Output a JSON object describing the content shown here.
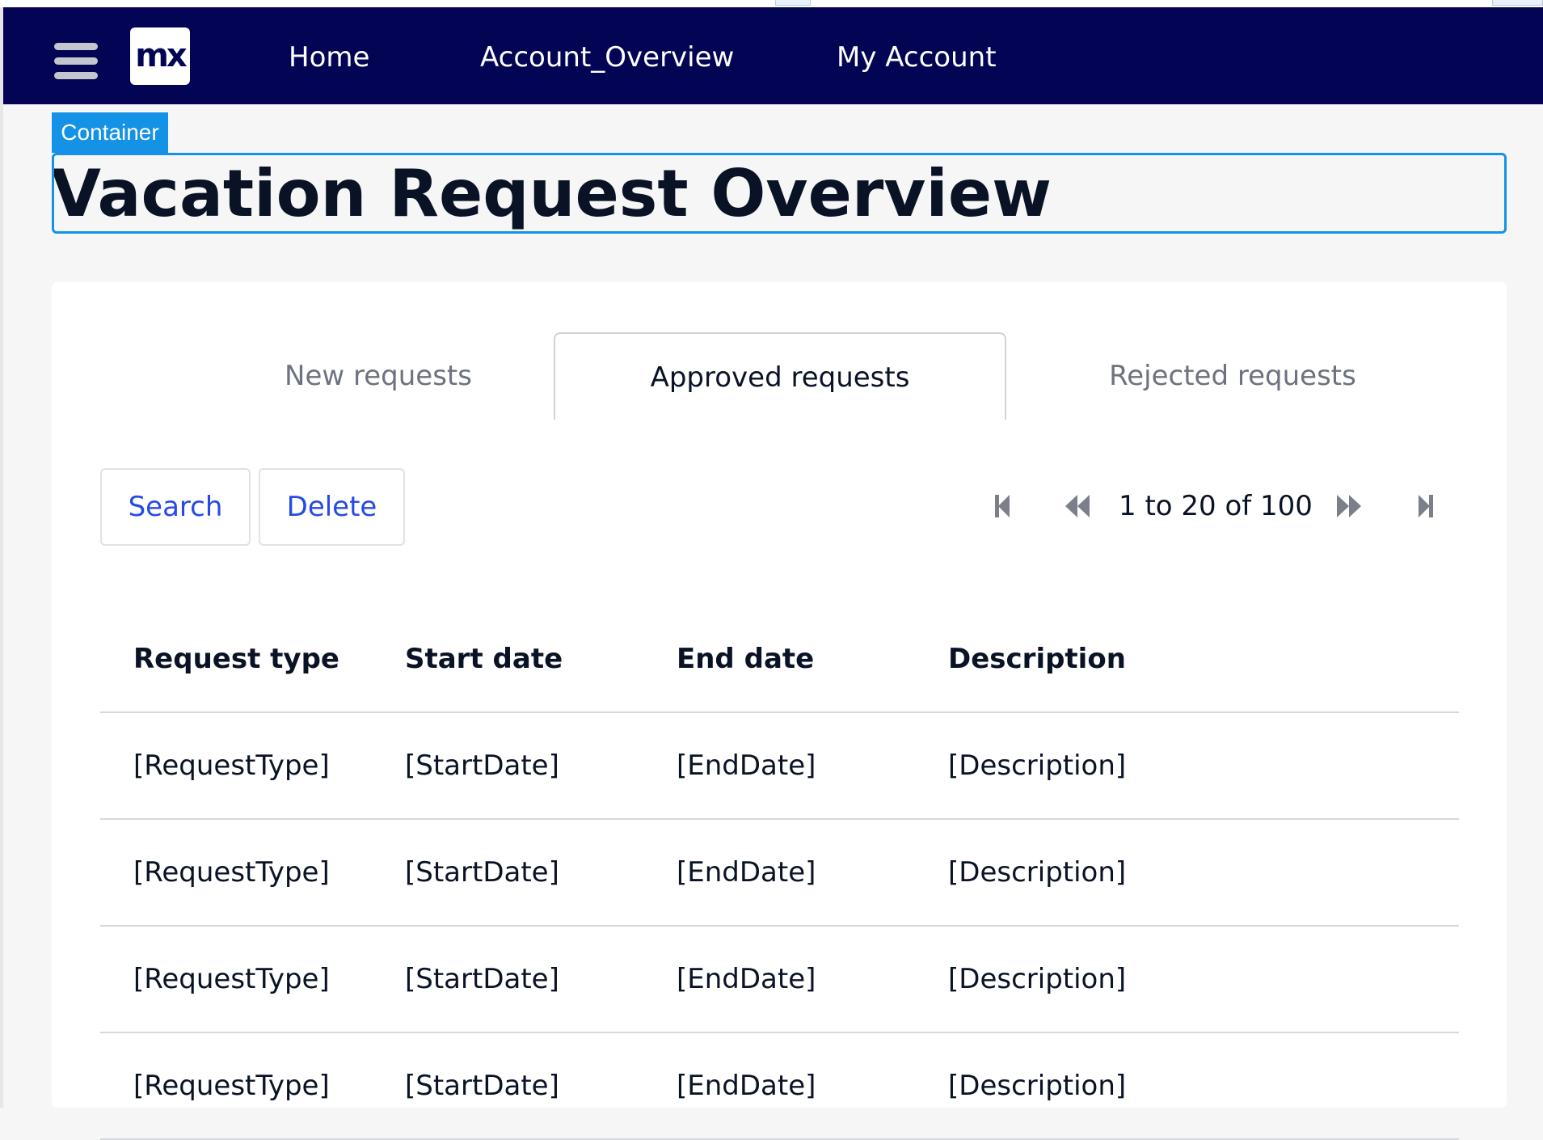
{
  "navbar": {
    "logo_text": "mx",
    "links": [
      "Home",
      "Account_Overview",
      "My Account"
    ],
    "background_color": "#030554"
  },
  "overlay": {
    "container_label": "Container",
    "highlight_color": "#1492e6"
  },
  "page": {
    "title": "Vacation Request Overview"
  },
  "tabs": [
    {
      "label": "New requests",
      "active": false
    },
    {
      "label": "Approved requests",
      "active": true
    },
    {
      "label": "Rejected requests",
      "active": false
    }
  ],
  "toolbar": {
    "search_label": "Search",
    "delete_label": "Delete",
    "button_text_color": "#264ae5"
  },
  "pager": {
    "text": "1 to 20 of 100",
    "icons": [
      "skip-first-icon",
      "previous-icon",
      "next-icon",
      "skip-last-icon"
    ]
  },
  "grid": {
    "columns": [
      "Request type",
      "Start date",
      "End date",
      "Description"
    ],
    "rows": [
      [
        "[RequestType]",
        "[StartDate]",
        "[EndDate]",
        "[Description]"
      ],
      [
        "[RequestType]",
        "[StartDate]",
        "[EndDate]",
        "[Description]"
      ],
      [
        "[RequestType]",
        "[StartDate]",
        "[EndDate]",
        "[Description]"
      ],
      [
        "[RequestType]",
        "[StartDate]",
        "[EndDate]",
        "[Description]"
      ]
    ]
  }
}
